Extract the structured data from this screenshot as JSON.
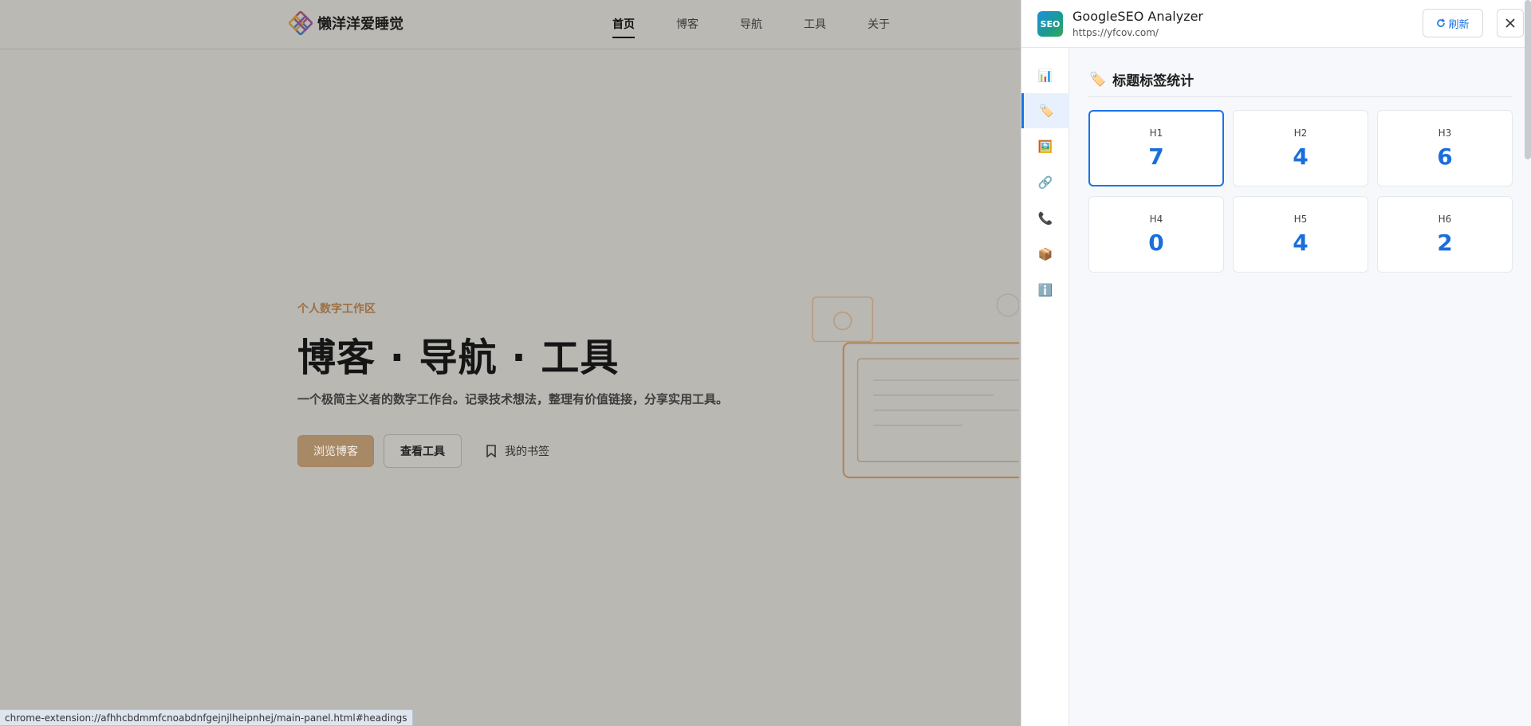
{
  "site": {
    "logo_text": "懒洋洋爱睡觉",
    "nav": [
      "首页",
      "博客",
      "导航",
      "工具",
      "关于"
    ],
    "active_nav": "首页",
    "hero": {
      "eyebrow": "个人数字工作区",
      "title": "博客 · 导航 · 工具",
      "description": "一个极简主义者的数字工作台。记录技术想法，整理有价值链接，分享实用工具。",
      "primary_button": "浏览博客",
      "secondary_button": "查看工具",
      "bookmark_link": "我的书签"
    },
    "status_url": "chrome-extension://afhhcbdmmfcnoabdnfgejnjlheipnhej/main-panel.html#headings"
  },
  "panel": {
    "logo_text": "SEO",
    "title": "GoogleSEO Analyzer",
    "url": "https://yfcov.com/",
    "refresh_label": "刷新",
    "side_nav": [
      {
        "name": "chart-icon",
        "glyph": "📊",
        "active": false
      },
      {
        "name": "tag-icon",
        "glyph": "🏷️",
        "active": true
      },
      {
        "name": "image-icon",
        "glyph": "🖼️",
        "active": false
      },
      {
        "name": "link-icon",
        "glyph": "🔗",
        "active": false
      },
      {
        "name": "phone-icon",
        "glyph": "📞",
        "active": false
      },
      {
        "name": "package-icon",
        "glyph": "📦",
        "active": false
      },
      {
        "name": "info-icon",
        "glyph": "ℹ️",
        "active": false
      }
    ],
    "section_title": "标题标签统计",
    "section_icon": "🏷️",
    "headings": [
      {
        "label": "H1",
        "value": "7"
      },
      {
        "label": "H2",
        "value": "4"
      },
      {
        "label": "H3",
        "value": "6"
      },
      {
        "label": "H4",
        "value": "0"
      },
      {
        "label": "H5",
        "value": "4"
      },
      {
        "label": "H6",
        "value": "2"
      }
    ],
    "colors": {
      "accent": "#1a73e8",
      "value": "#1a6fdc"
    }
  }
}
